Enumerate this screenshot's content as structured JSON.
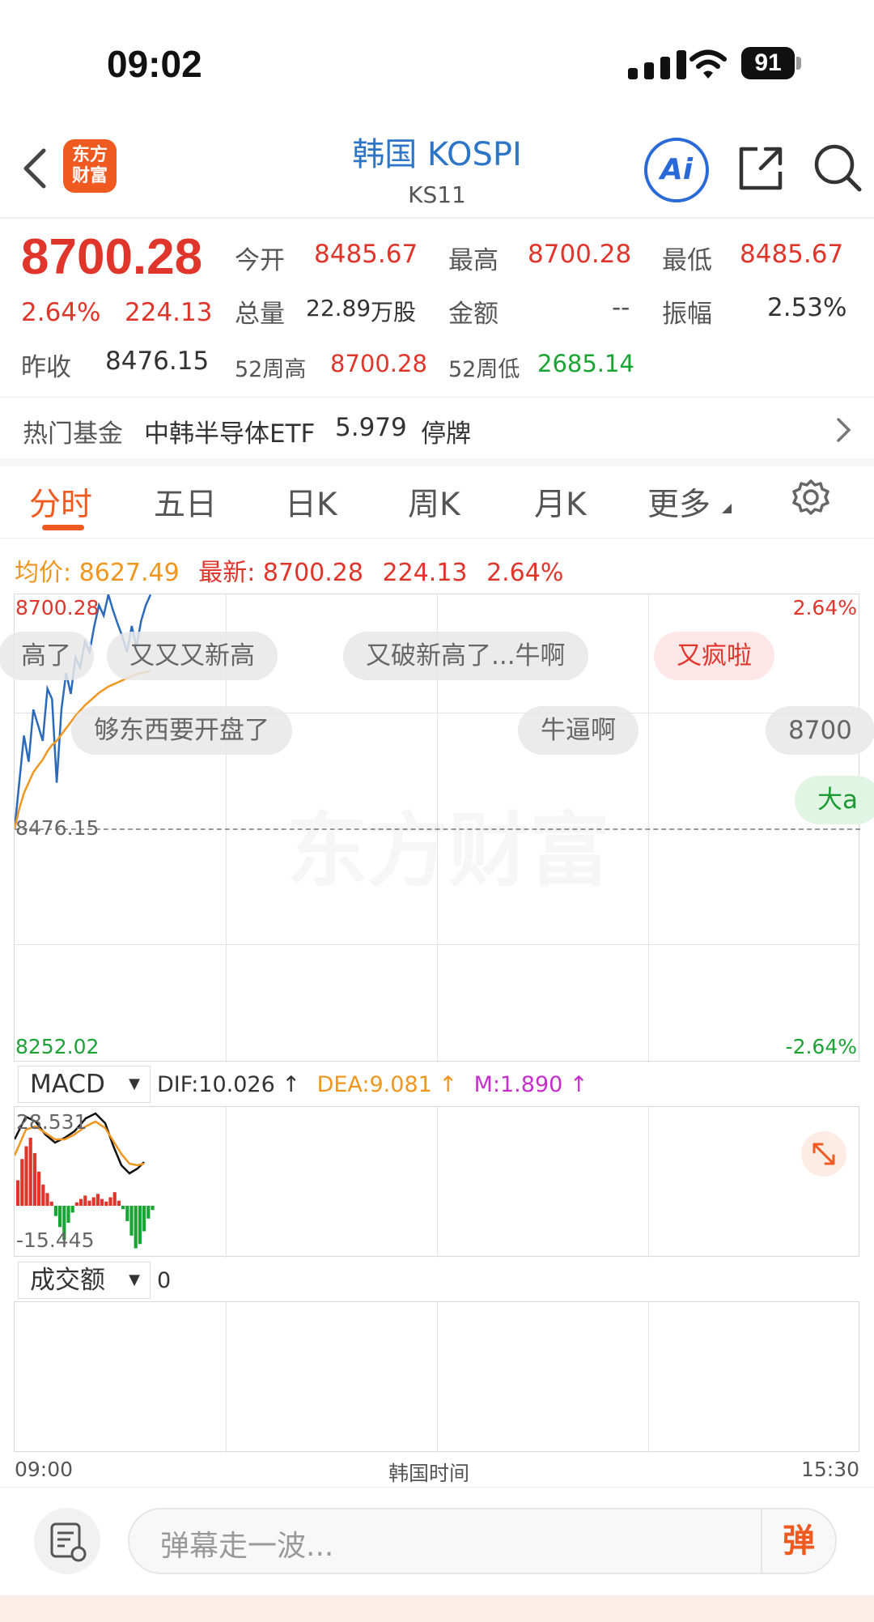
{
  "status_bar": {
    "time": "09:02",
    "battery": "91"
  },
  "nav": {
    "title": "韩国 KOSPI",
    "code": "KS11",
    "logo_text": "东方财富",
    "ai_label": "Ai"
  },
  "quote": {
    "last_price": "8700.28",
    "change_pct": "2.64%",
    "change_abs": "224.13",
    "prev_close_label": "昨收",
    "prev_close": "8476.15",
    "open_label": "今开",
    "open": "8485.67",
    "high_label": "最高",
    "high": "8700.28",
    "low_label": "最低",
    "low": "8485.67",
    "volume_label": "总量",
    "volume": "22.89",
    "volume_unit": "万股",
    "amount_label": "金额",
    "amount": "--",
    "amplitude_label": "振幅",
    "amplitude": "2.53%",
    "high52_label": "52周高",
    "high52": "8700.28",
    "low52_label": "52周低",
    "low52": "2685.14"
  },
  "fund": {
    "label": "热门基金",
    "name": "中韩半导体ETF",
    "price": "5.979",
    "status": "停牌"
  },
  "tabs": [
    "分时",
    "五日",
    "日K",
    "周K",
    "月K",
    "更多"
  ],
  "avg_line": {
    "avg_label": "均价:",
    "avg": "8627.49",
    "latest_label": "最新:",
    "latest": "8700.28",
    "change_abs": "224.13",
    "change_pct": "2.64%"
  },
  "chart_labels": {
    "top_left": "8700.28",
    "top_right": "2.64%",
    "mid_left": "8476.15",
    "bottom_left": "8252.02",
    "bottom_right": "-2.64%",
    "watermark": "东方财富",
    "time_start": "09:00",
    "time_mid": "韩国时间",
    "time_end": "15:30"
  },
  "danmu": [
    {
      "text": "高了"
    },
    {
      "text": "又又又新高"
    },
    {
      "text": "又破新高了...牛啊"
    },
    {
      "text": "又疯啦"
    },
    {
      "text": "够东西要开盘了"
    },
    {
      "text": "牛逼啊"
    },
    {
      "text": "8700"
    },
    {
      "text": "大a"
    }
  ],
  "macd": {
    "selector": "MACD",
    "dif": "DIF:10.026 ↑",
    "dea": "DEA:9.081 ↑",
    "m": "M:1.890 ↑",
    "top_label": "28.531",
    "bottom_label": "-15.445"
  },
  "volume_panel": {
    "selector": "成交额",
    "value": "0"
  },
  "comment": {
    "placeholder": "弹幕走一波...",
    "send_label": "弹"
  },
  "colors": {
    "up": "#e0352b",
    "down": "#1aa434",
    "avg": "#f0961e",
    "price_line": "#2a6ab8",
    "brand": "#ee5a1f"
  },
  "chart_data": {
    "type": "line",
    "title": "",
    "x_range": [
      "09:00",
      "15:30"
    ],
    "ylim": [
      8252.02,
      8700.28
    ],
    "reference": 8476.15,
    "series": [
      {
        "name": "最新",
        "values": [
          8476,
          8520,
          8565,
          8540,
          8590,
          8575,
          8560,
          8610,
          8600,
          8520,
          8590,
          8625,
          8605,
          8640,
          8630,
          8655,
          8645,
          8670,
          8690,
          8680,
          8700,
          8685,
          8672,
          8660,
          8645,
          8670,
          8650,
          8675,
          8690,
          8700
        ]
      },
      {
        "name": "均价",
        "values": [
          8476,
          8495,
          8510,
          8520,
          8530,
          8536,
          8542,
          8550,
          8556,
          8560,
          8566,
          8572,
          8578,
          8584,
          8589,
          8594,
          8598,
          8602,
          8606,
          8609,
          8612,
          8614,
          8616,
          8618,
          8620,
          8622,
          8624,
          8625,
          8626,
          8627
        ]
      }
    ]
  }
}
